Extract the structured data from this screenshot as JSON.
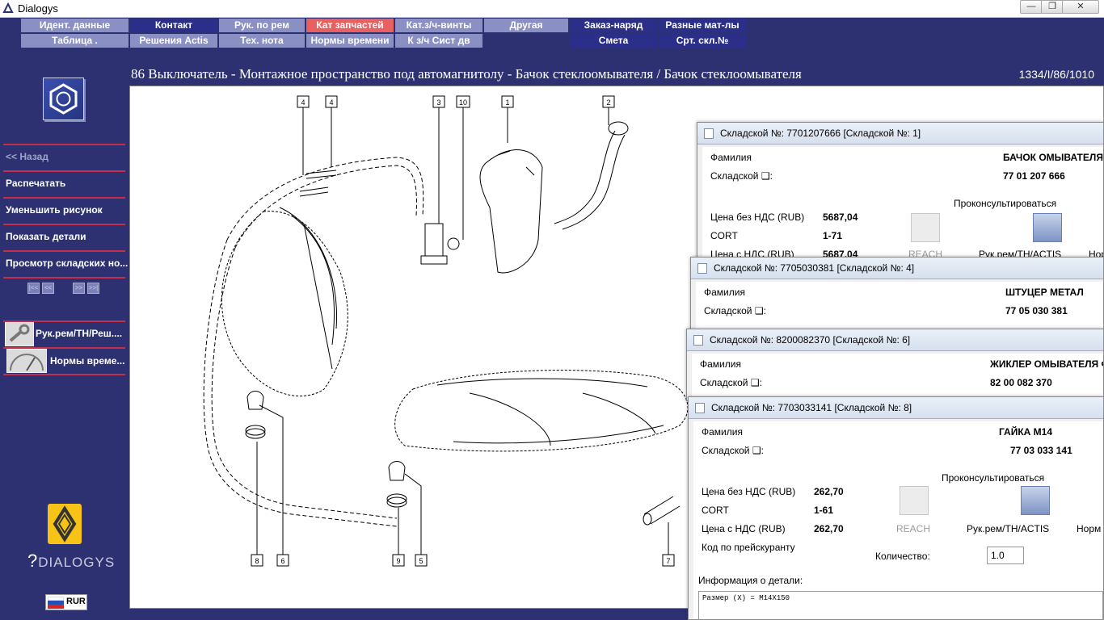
{
  "window": {
    "title": "Dialogys",
    "min": "—",
    "max": "❐",
    "close": "✕"
  },
  "menu": {
    "row1": [
      "Идент. данные",
      "Контакт",
      "Рук. по рем",
      "Кат запчастей",
      "Кат.з/ч-винты",
      "Другая",
      "Заказ-наряд",
      "Разные мат-лы"
    ],
    "row2": [
      "Таблица .",
      "Решения Actis",
      "Тех. нота",
      "Нормы времени",
      "К з/ч Сист дв",
      "Смета",
      "Срт. скл.№"
    ]
  },
  "heading": "86 Выключатель - Монтажное пространство под автомагнитолу - Бачок стеклоомывателя / Бачок стеклоомывателя",
  "ref_code": "1334/I/86/1010",
  "sidebar": {
    "back": "<< Назад",
    "items": [
      "Распечатать",
      "Уменьшить рисунок",
      "Показать детали",
      "Просмотр складских но..."
    ],
    "pager": [
      "|<<",
      "<<",
      ">>",
      ">>|"
    ],
    "shortcuts": [
      "Рук.рем/ТН/Реш....",
      "Нормы време..."
    ],
    "brand": "DIALOGYS",
    "currency": "RUR"
  },
  "callouts": [
    "4",
    "4",
    "3",
    "10",
    "1",
    "2",
    "8",
    "6",
    "9",
    "5",
    "7"
  ],
  "dialogs": [
    {
      "title": "Складской №: 7701207666 [Складской №: 1]",
      "family_label": "Фамилия",
      "family_value": "БАЧОК ОМЫВАТЕЛЯ",
      "stock_label": "Складской ❑:",
      "stock_value": "77 01 207 666",
      "consult": "Проконсультироваться",
      "price_no_vat_label": "Цена без НДС (RUB)",
      "price_no_vat": "5687,04",
      "cort_label": "CORT",
      "cort": "1-71",
      "price_vat_label": "Цена с НДС (RUB)",
      "price_vat": "5687,04",
      "reach": "REACH",
      "manual": "Рук.рем/ТН/ACTIS",
      "norms": "Норм"
    },
    {
      "title": "Складской №: 7705030381 [Складской №: 4]",
      "family_label": "Фамилия",
      "family_value": "ШТУЦЕР   МЕТАЛ",
      "stock_label": "Складской ❑:",
      "stock_value": "77 05 030 381"
    },
    {
      "title": "Складской №: 8200082370 [Складской №: 6]",
      "family_label": "Фамилия",
      "family_value": "ЖИКЛЕР ОМЫВАТЕЛЯ Ф",
      "stock_label": "Складской ❑:",
      "stock_value": "82 00 082 370"
    },
    {
      "title": "Складской №: 7703033141 [Складской №: 8]",
      "family_label": "Фамилия",
      "family_value": "ГАЙКА М14",
      "stock_label": "Складской ❑:",
      "stock_value": "77 03 033 141",
      "consult": "Проконсультироваться",
      "price_no_vat_label": "Цена без НДС (RUB)",
      "price_no_vat": "262,70",
      "cort_label": "CORT",
      "cort": "1-61",
      "price_vat_label": "Цена с НДС (RUB)",
      "price_vat": "262,70",
      "reach": "REACH",
      "manual": "Рук.рем/ТН/ACTIS",
      "norms": "Норм",
      "price_code_label": "Код по прейскуранту",
      "qty_label": "Количество:",
      "qty": "1.0",
      "info_label": "Информация о детали:",
      "info_text": "Размер (X) = M14X150"
    }
  ]
}
